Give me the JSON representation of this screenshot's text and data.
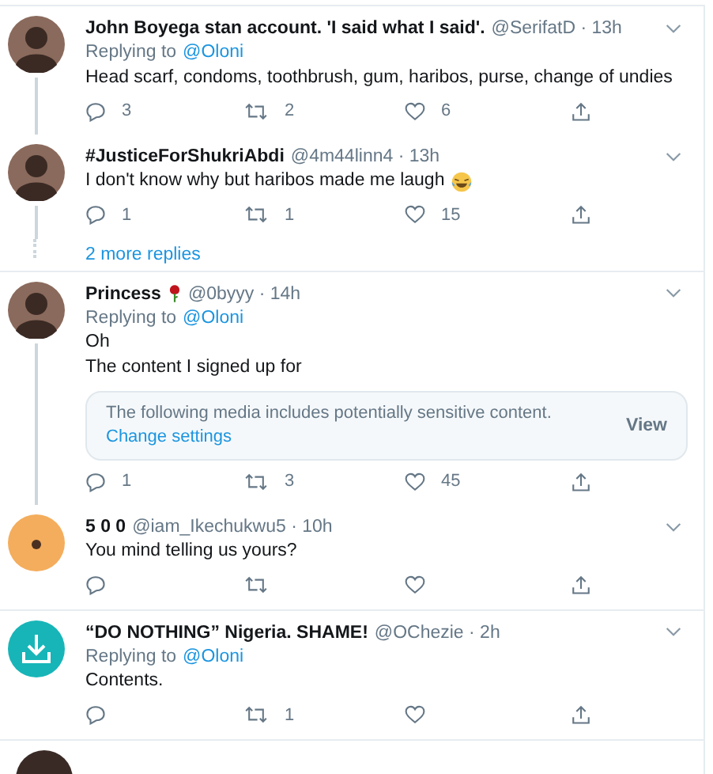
{
  "items": [
    {
      "kind": "tweet",
      "avatar": {
        "kind": "photo"
      },
      "name": "John Boyega stan account. 'I said what I said'.",
      "handle": "@SerifatD",
      "separator": "·",
      "time": "13h",
      "replying_to": "Replying to",
      "reply_handle": "@Oloni",
      "lines": [
        "Head scarf, condoms, toothbrush, gum, haribos, purse, change of undies"
      ],
      "replies": "3",
      "retweets": "2",
      "likes": "6",
      "thread_line": true,
      "divider_after": false
    },
    {
      "kind": "tweet",
      "avatar": {
        "kind": "photo"
      },
      "name": "#JusticeForShukriAbdi",
      "handle": "@4m44linn4",
      "separator": "·",
      "time": "13h",
      "lines": [
        "I don't know why but haribos made me laugh"
      ],
      "trailing_emoji": {
        "kind": "laughing"
      },
      "replies": "1",
      "retweets": "1",
      "likes": "15",
      "thread_line": true,
      "divider_after": false
    },
    {
      "kind": "more_replies",
      "label": "2 more replies",
      "divider_after": true
    },
    {
      "kind": "tweet",
      "avatar": {
        "kind": "photo"
      },
      "name": "Princess",
      "name_emoji": {
        "kind": "rose"
      },
      "handle": "@0byyy",
      "separator": "·",
      "time": "14h",
      "replying_to": "Replying to",
      "reply_handle": "@Oloni",
      "lines": [
        "Oh",
        "The content I signed up for"
      ],
      "sensitive": {
        "message": "The following media includes potentially sensitive content.",
        "link": "Change settings",
        "button": "View"
      },
      "replies": "1",
      "retweets": "3",
      "likes": "45",
      "thread_line": true,
      "divider_after": false
    },
    {
      "kind": "tweet",
      "avatar": {
        "kind": "illustration"
      },
      "name": "5 0 0",
      "handle": "@iam_Ikechukwu5",
      "separator": "·",
      "time": "10h",
      "lines": [
        "You mind telling us yours?"
      ],
      "thread_line": false,
      "divider_after": true
    },
    {
      "kind": "tweet",
      "avatar": {
        "kind": "download"
      },
      "name": "“DO NOTHING” Nigeria. SHAME!",
      "handle": "@OChezie",
      "separator": "·",
      "time": "2h",
      "replying_to": "Replying to",
      "reply_handle": "@Oloni",
      "lines": [
        "Contents."
      ],
      "retweets": "1",
      "thread_line": false,
      "divider_after": true
    }
  ]
}
